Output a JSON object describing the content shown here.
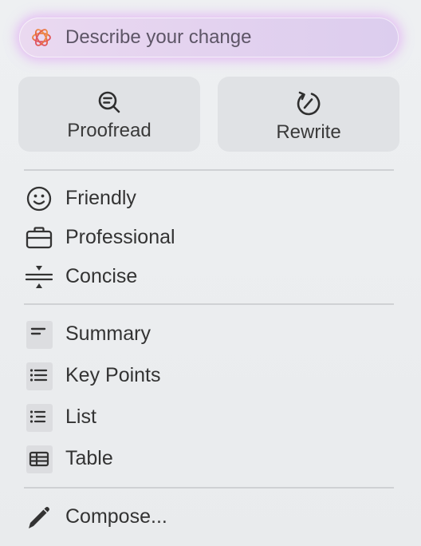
{
  "prompt": {
    "placeholder": "Describe your change",
    "icon": "writing-tools-sparkle-icon"
  },
  "tiles": [
    {
      "label": "Proofread",
      "icon": "magnifier-check-icon"
    },
    {
      "label": "Rewrite",
      "icon": "circular-arrow-icon"
    }
  ],
  "tone_items": [
    {
      "label": "Friendly",
      "icon": "smiley-icon"
    },
    {
      "label": "Professional",
      "icon": "briefcase-icon"
    },
    {
      "label": "Concise",
      "icon": "compress-icon"
    }
  ],
  "format_items": [
    {
      "label": "Summary",
      "icon": "summary-lines-icon"
    },
    {
      "label": "Key Points",
      "icon": "bulleted-list-icon"
    },
    {
      "label": "List",
      "icon": "list-icon"
    },
    {
      "label": "Table",
      "icon": "table-icon"
    }
  ],
  "compose": {
    "label": "Compose...",
    "icon": "pencil-icon"
  },
  "colors": {
    "prompt_glow": "#dc96f5",
    "panel_background": "#eceef0",
    "tile_background": "#e0e2e5",
    "text": "#333333"
  }
}
